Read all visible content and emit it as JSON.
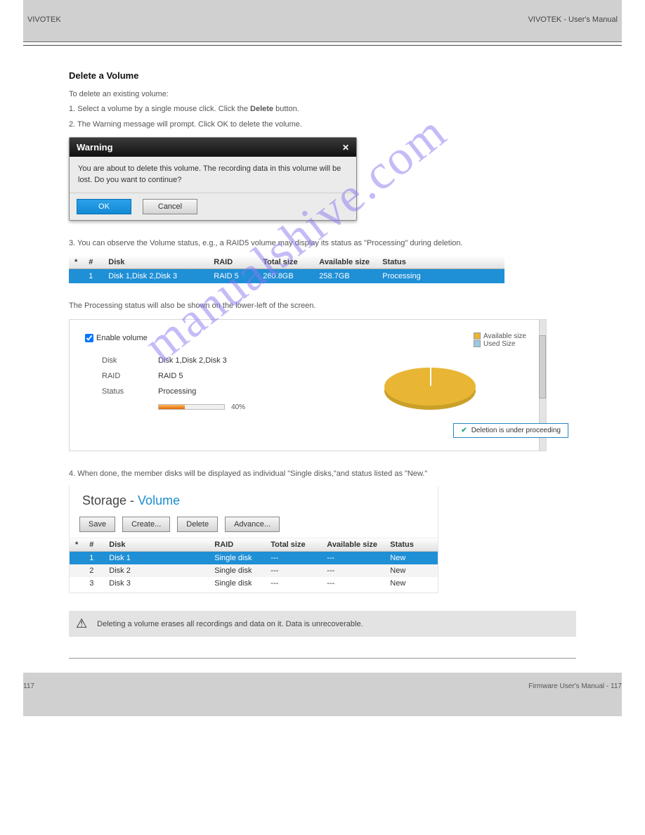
{
  "header": {
    "left": "VIVOTEK",
    "right": "VIVOTEK - User's Manual"
  },
  "section_delete_title": "Delete a Volume",
  "text": {
    "p1": "To delete an existing volume:",
    "p2_a": "1. Select a volume by a single mouse click. Click the ",
    "p2_b": "Delete",
    "p2_c": " button.",
    "p3": "2. The Warning message will prompt. Click OK to delete the volume.",
    "p4": "3. You can observe the Volume status, e.g., a RAID5 volume may display its status as \"Processing\" during deletion.",
    "p5": "The Processing status will also be shown on the lower-left of the screen.",
    "p6": "4. When done, the member disks will be displayed as individual \"Single disks,\"and status listed as \"New.\""
  },
  "warning_dialog": {
    "title": "Warning",
    "message": "You are about to delete this volume. The recording data in this volume will be lost. Do you want to continue?",
    "ok": "OK",
    "cancel": "Cancel"
  },
  "vol_table": {
    "cols": [
      "*",
      "#",
      "Disk",
      "RAID",
      "Total size",
      "Available size",
      "Status"
    ],
    "row": {
      "num": "1",
      "disk": "Disk 1,Disk 2,Disk 3",
      "raid": "RAID 5",
      "total": "260.8GB",
      "avail": "258.7GB",
      "status": "Processing"
    }
  },
  "enable_panel": {
    "enable_label": "Enable volume",
    "rows": {
      "disk_label": "Disk",
      "disk_value": "Disk 1,Disk 2,Disk 3",
      "raid_label": "RAID",
      "raid_value": "RAID 5",
      "status_label": "Status",
      "status_value": "Processing",
      "progress_pct": "40%"
    },
    "legend": {
      "avail": "Available size",
      "used": "Used Size"
    },
    "toast": "Deletion is under proceeding"
  },
  "storage_panel": {
    "breadcrumb_a": "Storage",
    "breadcrumb_sep": " - ",
    "breadcrumb_b": "Volume",
    "buttons": {
      "save": "Save",
      "create": "Create...",
      "delete": "Delete",
      "advance": "Advance..."
    },
    "cols": [
      "*",
      "#",
      "Disk",
      "RAID",
      "Total size",
      "Available size",
      "Status"
    ],
    "rows": [
      {
        "num": "1",
        "disk": "Disk 1",
        "raid": "Single disk",
        "total": "---",
        "avail": "---",
        "status": "New"
      },
      {
        "num": "2",
        "disk": "Disk 2",
        "raid": "Single disk",
        "total": "---",
        "avail": "---",
        "status": "New"
      },
      {
        "num": "3",
        "disk": "Disk 3",
        "raid": "Single disk",
        "total": "---",
        "avail": "---",
        "status": "New"
      }
    ]
  },
  "caution": "Deleting a volume erases all recordings and data on it. Data is unrecoverable.",
  "footer": {
    "left": "117",
    "right_a": "Firmware User's Manual - ",
    "right_b": "117"
  },
  "chart_data": {
    "type": "pie",
    "title": "",
    "series": [
      {
        "name": "Available size",
        "value": 99,
        "color": "#e8b634"
      },
      {
        "name": "Used Size",
        "value": 1,
        "color": "#9ec9e2"
      }
    ],
    "legend_position": "top-right"
  },
  "watermark": "manualshive.com"
}
